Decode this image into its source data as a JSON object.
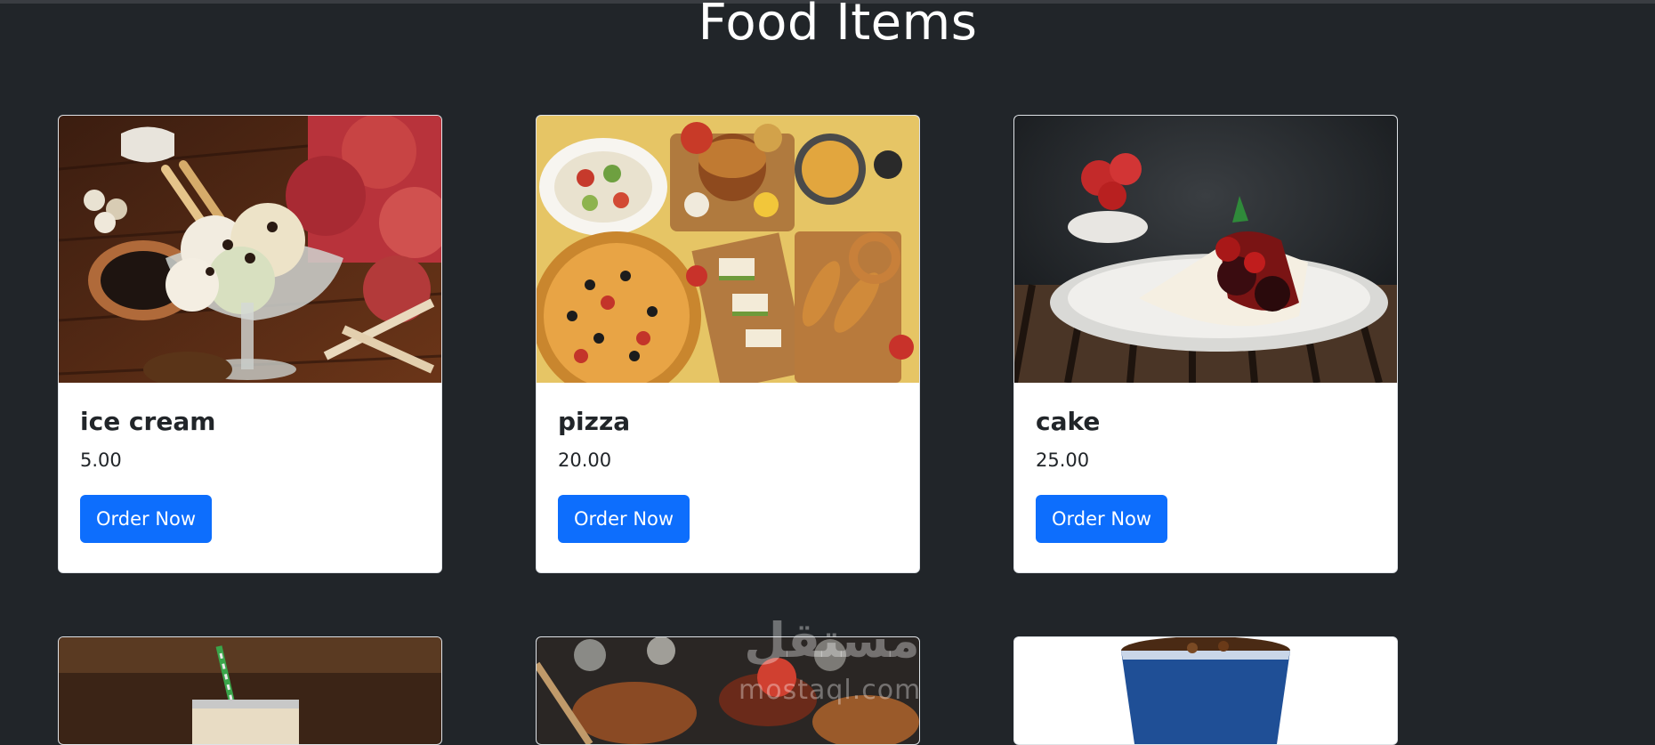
{
  "page": {
    "title": "Food Items"
  },
  "items": [
    {
      "name": "ice cream",
      "price": "5.00",
      "button": "Order Now"
    },
    {
      "name": "pizza",
      "price": "20.00",
      "button": "Order Now"
    },
    {
      "name": "cake",
      "price": "25.00",
      "button": "Order Now"
    }
  ],
  "watermark": {
    "mark": "مستقل",
    "url": "mostaql.com"
  }
}
